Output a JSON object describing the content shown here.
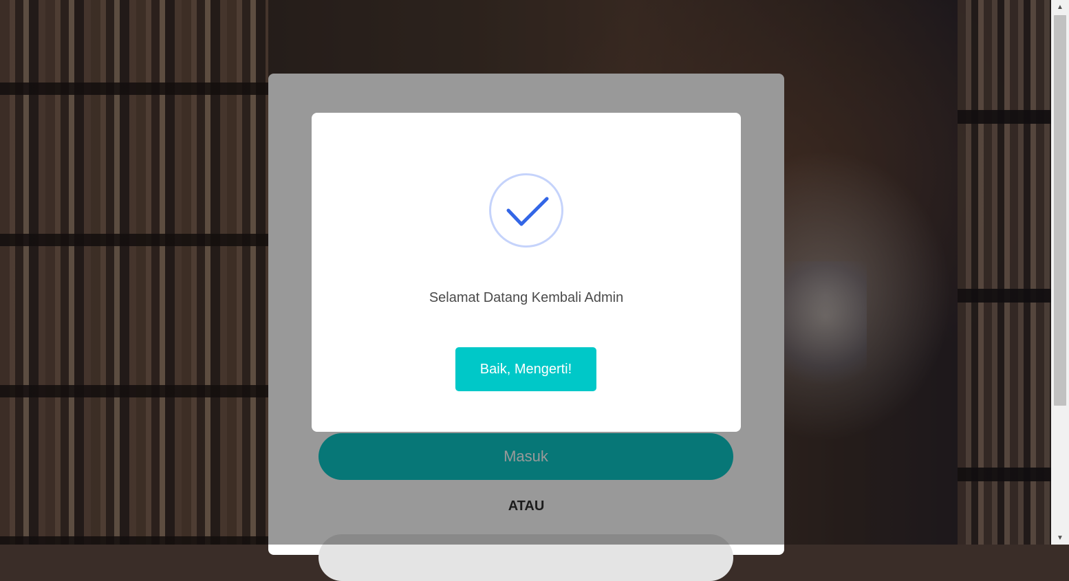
{
  "login": {
    "submit_label": "Masuk",
    "or_label": "ATAU"
  },
  "modal": {
    "icon": "check-circle-icon",
    "message": "Selamat Datang Kembali Admin",
    "confirm_label": "Baik, Mengerti!"
  },
  "colors": {
    "accent": "#00c8c8",
    "check": "#3366e6",
    "check_ring": "#c5d3fb"
  },
  "icons": {
    "scroll_up": "scroll-up-arrow-icon",
    "scroll_down": "scroll-down-arrow-icon"
  }
}
